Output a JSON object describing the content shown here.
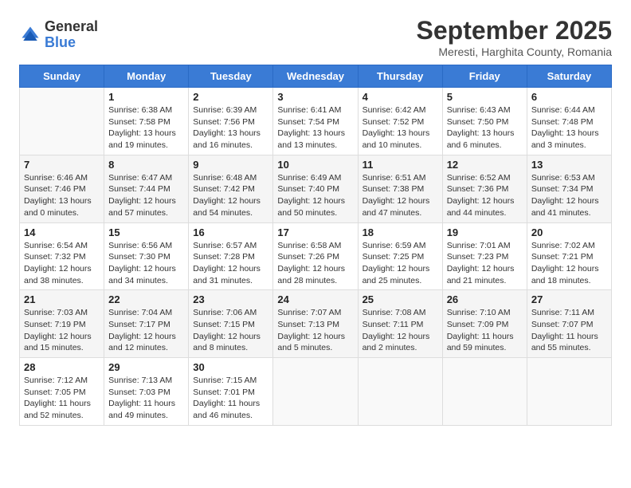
{
  "header": {
    "logo_general": "General",
    "logo_blue": "Blue",
    "month_title": "September 2025",
    "location": "Meresti, Harghita County, Romania"
  },
  "days_of_week": [
    "Sunday",
    "Monday",
    "Tuesday",
    "Wednesday",
    "Thursday",
    "Friday",
    "Saturday"
  ],
  "weeks": [
    [
      {
        "day": "",
        "info": ""
      },
      {
        "day": "1",
        "info": "Sunrise: 6:38 AM\nSunset: 7:58 PM\nDaylight: 13 hours\nand 19 minutes."
      },
      {
        "day": "2",
        "info": "Sunrise: 6:39 AM\nSunset: 7:56 PM\nDaylight: 13 hours\nand 16 minutes."
      },
      {
        "day": "3",
        "info": "Sunrise: 6:41 AM\nSunset: 7:54 PM\nDaylight: 13 hours\nand 13 minutes."
      },
      {
        "day": "4",
        "info": "Sunrise: 6:42 AM\nSunset: 7:52 PM\nDaylight: 13 hours\nand 10 minutes."
      },
      {
        "day": "5",
        "info": "Sunrise: 6:43 AM\nSunset: 7:50 PM\nDaylight: 13 hours\nand 6 minutes."
      },
      {
        "day": "6",
        "info": "Sunrise: 6:44 AM\nSunset: 7:48 PM\nDaylight: 13 hours\nand 3 minutes."
      }
    ],
    [
      {
        "day": "7",
        "info": "Sunrise: 6:46 AM\nSunset: 7:46 PM\nDaylight: 13 hours\nand 0 minutes."
      },
      {
        "day": "8",
        "info": "Sunrise: 6:47 AM\nSunset: 7:44 PM\nDaylight: 12 hours\nand 57 minutes."
      },
      {
        "day": "9",
        "info": "Sunrise: 6:48 AM\nSunset: 7:42 PM\nDaylight: 12 hours\nand 54 minutes."
      },
      {
        "day": "10",
        "info": "Sunrise: 6:49 AM\nSunset: 7:40 PM\nDaylight: 12 hours\nand 50 minutes."
      },
      {
        "day": "11",
        "info": "Sunrise: 6:51 AM\nSunset: 7:38 PM\nDaylight: 12 hours\nand 47 minutes."
      },
      {
        "day": "12",
        "info": "Sunrise: 6:52 AM\nSunset: 7:36 PM\nDaylight: 12 hours\nand 44 minutes."
      },
      {
        "day": "13",
        "info": "Sunrise: 6:53 AM\nSunset: 7:34 PM\nDaylight: 12 hours\nand 41 minutes."
      }
    ],
    [
      {
        "day": "14",
        "info": "Sunrise: 6:54 AM\nSunset: 7:32 PM\nDaylight: 12 hours\nand 38 minutes."
      },
      {
        "day": "15",
        "info": "Sunrise: 6:56 AM\nSunset: 7:30 PM\nDaylight: 12 hours\nand 34 minutes."
      },
      {
        "day": "16",
        "info": "Sunrise: 6:57 AM\nSunset: 7:28 PM\nDaylight: 12 hours\nand 31 minutes."
      },
      {
        "day": "17",
        "info": "Sunrise: 6:58 AM\nSunset: 7:26 PM\nDaylight: 12 hours\nand 28 minutes."
      },
      {
        "day": "18",
        "info": "Sunrise: 6:59 AM\nSunset: 7:25 PM\nDaylight: 12 hours\nand 25 minutes."
      },
      {
        "day": "19",
        "info": "Sunrise: 7:01 AM\nSunset: 7:23 PM\nDaylight: 12 hours\nand 21 minutes."
      },
      {
        "day": "20",
        "info": "Sunrise: 7:02 AM\nSunset: 7:21 PM\nDaylight: 12 hours\nand 18 minutes."
      }
    ],
    [
      {
        "day": "21",
        "info": "Sunrise: 7:03 AM\nSunset: 7:19 PM\nDaylight: 12 hours\nand 15 minutes."
      },
      {
        "day": "22",
        "info": "Sunrise: 7:04 AM\nSunset: 7:17 PM\nDaylight: 12 hours\nand 12 minutes."
      },
      {
        "day": "23",
        "info": "Sunrise: 7:06 AM\nSunset: 7:15 PM\nDaylight: 12 hours\nand 8 minutes."
      },
      {
        "day": "24",
        "info": "Sunrise: 7:07 AM\nSunset: 7:13 PM\nDaylight: 12 hours\nand 5 minutes."
      },
      {
        "day": "25",
        "info": "Sunrise: 7:08 AM\nSunset: 7:11 PM\nDaylight: 12 hours\nand 2 minutes."
      },
      {
        "day": "26",
        "info": "Sunrise: 7:10 AM\nSunset: 7:09 PM\nDaylight: 11 hours\nand 59 minutes."
      },
      {
        "day": "27",
        "info": "Sunrise: 7:11 AM\nSunset: 7:07 PM\nDaylight: 11 hours\nand 55 minutes."
      }
    ],
    [
      {
        "day": "28",
        "info": "Sunrise: 7:12 AM\nSunset: 7:05 PM\nDaylight: 11 hours\nand 52 minutes."
      },
      {
        "day": "29",
        "info": "Sunrise: 7:13 AM\nSunset: 7:03 PM\nDaylight: 11 hours\nand 49 minutes."
      },
      {
        "day": "30",
        "info": "Sunrise: 7:15 AM\nSunset: 7:01 PM\nDaylight: 11 hours\nand 46 minutes."
      },
      {
        "day": "",
        "info": ""
      },
      {
        "day": "",
        "info": ""
      },
      {
        "day": "",
        "info": ""
      },
      {
        "day": "",
        "info": ""
      }
    ]
  ]
}
